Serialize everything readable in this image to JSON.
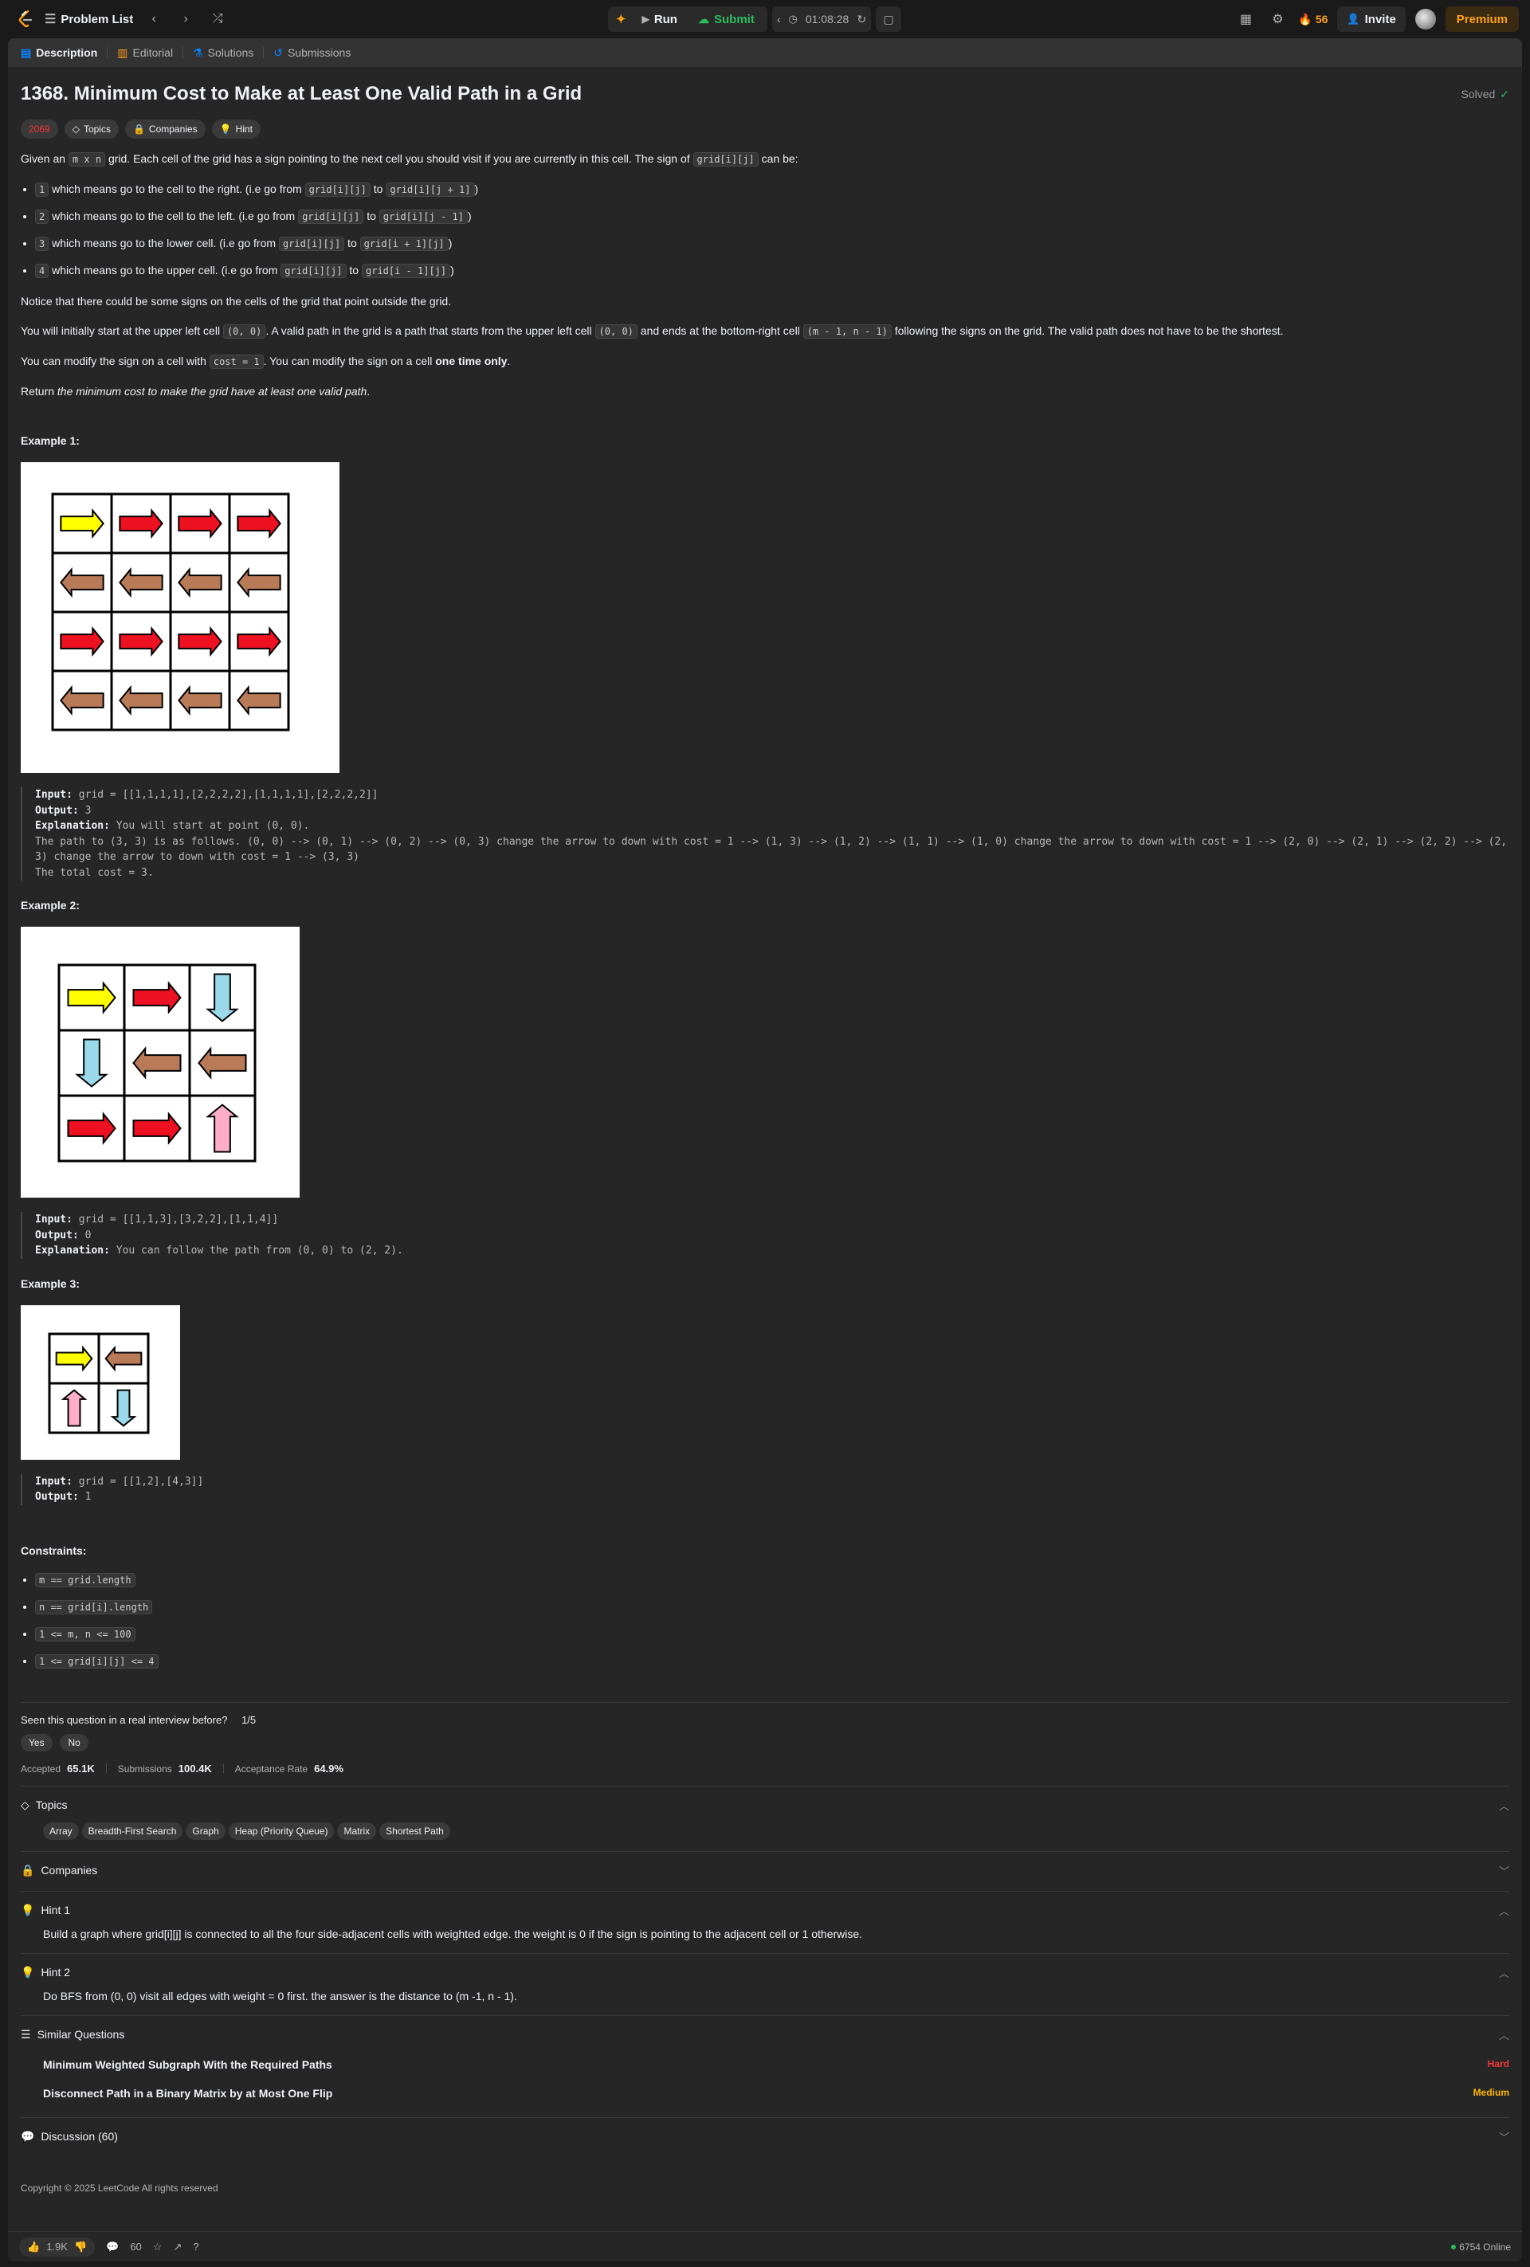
{
  "topbar": {
    "problem_list": "Problem List",
    "run": "Run",
    "submit": "Submit",
    "timer": "01:08:28",
    "streak": "56",
    "invite": "Invite",
    "premium": "Premium"
  },
  "tabs": [
    {
      "label": "Description",
      "icon": "description-icon"
    },
    {
      "label": "Editorial",
      "icon": "book-icon"
    },
    {
      "label": "Solutions",
      "icon": "flask-icon"
    },
    {
      "label": "Submissions",
      "icon": "history-icon"
    }
  ],
  "problem": {
    "title": "1368. Minimum Cost to Make at Least One Valid Path in a Grid",
    "solved": "Solved",
    "difficulty_badge": "2069",
    "tag_topics": "Topics",
    "tag_companies": "Companies",
    "tag_hint": "Hint",
    "intro_1": "Given an ",
    "intro_code_1": "m x n",
    "intro_2": " grid. Each cell of the grid has a sign pointing to the next cell you should visit if you are currently in this cell. The sign of ",
    "intro_code_2": "grid[i][j]",
    "intro_3": " can be:",
    "bullets": [
      {
        "num": "1",
        "text": " which means go to the cell to the right. (i.e go from ",
        "from": "grid[i][j]",
        "to_word": " to ",
        "to": "grid[i][j + 1]",
        "end": ")"
      },
      {
        "num": "2",
        "text": " which means go to the cell to the left. (i.e go from ",
        "from": "grid[i][j]",
        "to_word": " to ",
        "to": "grid[i][j - 1]",
        "end": ")"
      },
      {
        "num": "3",
        "text": " which means go to the lower cell. (i.e go from ",
        "from": "grid[i][j]",
        "to_word": " to ",
        "to": "grid[i + 1][j]",
        "end": ")"
      },
      {
        "num": "4",
        "text": " which means go to the upper cell. (i.e go from ",
        "from": "grid[i][j]",
        "to_word": " to ",
        "to": "grid[i - 1][j]",
        "end": ")"
      }
    ],
    "notice": "Notice that there could be some signs on the cells of the grid that point outside the grid.",
    "start_1": "You will initially start at the upper left cell ",
    "start_code_1": "(0, 0)",
    "start_2": ". A valid path in the grid is a path that starts from the upper left cell ",
    "start_code_2": "(0, 0)",
    "start_3": " and ends at the bottom-right cell ",
    "start_code_3": "(m - 1, n - 1)",
    "start_4": " following the signs on the grid. The valid path does not have to be the shortest.",
    "modify_1": "You can modify the sign on a cell with ",
    "modify_code": "cost = 1",
    "modify_2": ". You can modify the sign on a cell ",
    "modify_bold": "one time only",
    "modify_3": ".",
    "return_1": "Return ",
    "return_em": "the minimum cost to make the grid have at least one valid path",
    "return_2": "."
  },
  "examples": [
    {
      "title": "Example 1:",
      "grid": [
        [
          1,
          1,
          1,
          1
        ],
        [
          2,
          2,
          2,
          2
        ],
        [
          1,
          1,
          1,
          1
        ],
        [
          2,
          2,
          2,
          2
        ]
      ],
      "input_label": "Input:",
      "input": "grid = [[1,1,1,1],[2,2,2,2],[1,1,1,1],[2,2,2,2]]",
      "output_label": "Output:",
      "output": "3",
      "explanation_label": "Explanation:",
      "explanation": "You will start at point (0, 0).\nThe path to (3, 3) is as follows. (0, 0) --> (0, 1) --> (0, 2) --> (0, 3) change the arrow to down with cost = 1 --> (1, 3) --> (1, 2) --> (1, 1) --> (1, 0) change the arrow to down with cost = 1 --> (2, 0) --> (2, 1) --> (2, 2) --> (2, 3) change the arrow to down with cost = 1 --> (3, 3)\nThe total cost = 3."
    },
    {
      "title": "Example 2:",
      "grid": [
        [
          1,
          1,
          3
        ],
        [
          3,
          2,
          2
        ],
        [
          1,
          1,
          4
        ]
      ],
      "input_label": "Input:",
      "input": "grid = [[1,1,3],[3,2,2],[1,1,4]]",
      "output_label": "Output:",
      "output": "0",
      "explanation_label": "Explanation:",
      "explanation": "You can follow the path from (0, 0) to (2, 2)."
    },
    {
      "title": "Example 3:",
      "grid": [
        [
          1,
          2
        ],
        [
          4,
          3
        ]
      ],
      "input_label": "Input:",
      "input": "grid = [[1,2],[4,3]]",
      "output_label": "Output:",
      "output": "1"
    }
  ],
  "arrow_colors": {
    "start": "#ffff00",
    "right": "#ee1122",
    "left": "#b97a57",
    "down": "#99d9ea",
    "up": "#ffaec9"
  },
  "constraints": {
    "title": "Constraints:",
    "items": [
      "m == grid.length",
      "n == grid[i].length",
      "1 <= m, n <= 100",
      "1 <= grid[i][j] <= 4"
    ]
  },
  "seen": {
    "question": "Seen this question in a real interview before?",
    "ratio": "1/5",
    "yes": "Yes",
    "no": "No"
  },
  "stats": {
    "accepted_label": "Accepted",
    "accepted": "65.1K",
    "submissions_label": "Submissions",
    "submissions": "100.4K",
    "rate_label": "Acceptance Rate",
    "rate": "64.9%"
  },
  "topics": {
    "label": "Topics",
    "items": [
      "Array",
      "Breadth-First Search",
      "Graph",
      "Heap (Priority Queue)",
      "Matrix",
      "Shortest Path"
    ]
  },
  "companies": {
    "label": "Companies"
  },
  "hint1": {
    "label": "Hint 1",
    "text": "Build a graph where grid[i][j] is connected to all the four side-adjacent cells with weighted edge. the weight is 0 if the sign is pointing to the adjacent cell or 1 otherwise."
  },
  "hint2": {
    "label": "Hint 2",
    "text": "Do BFS from (0, 0) visit all edges with weight = 0 first. the answer is the distance to (m -1, n - 1)."
  },
  "similar": {
    "label": "Similar Questions",
    "items": [
      {
        "title": "Minimum Weighted Subgraph With the Required Paths",
        "difficulty": "Hard"
      },
      {
        "title": "Disconnect Path in a Binary Matrix by at Most One Flip",
        "difficulty": "Medium"
      }
    ]
  },
  "discussion": {
    "label": "Discussion (60)"
  },
  "copyright": "Copyright © 2025 LeetCode All rights reserved",
  "bottom": {
    "likes": "1.9K",
    "comments": "60",
    "online": "6754 Online"
  }
}
